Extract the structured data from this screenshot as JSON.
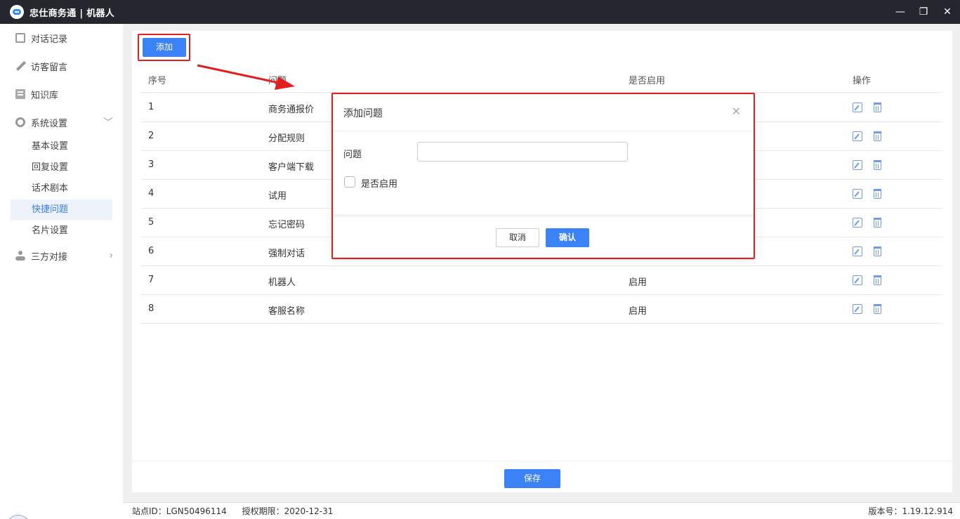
{
  "window": {
    "title": "忠仕商务通 | 机器人",
    "min_icon": "minimize-icon",
    "max_icon": "restore-icon",
    "close_icon": "close-icon"
  },
  "sidebar": {
    "items": [
      {
        "label": "对话记录",
        "icon": "chat-icon"
      },
      {
        "label": "访客留言",
        "icon": "pen-icon"
      },
      {
        "label": "知识库",
        "icon": "book-icon"
      },
      {
        "label": "系统设置",
        "icon": "gear-icon",
        "expanded": true
      },
      {
        "label": "三方对接",
        "icon": "link-icon",
        "expanded": false
      }
    ],
    "sub_items": [
      "基本设置",
      "回复设置",
      "话术剧本",
      "快捷问题",
      "名片设置"
    ],
    "active_sub": "快捷问题"
  },
  "toolbar": {
    "add_label": "添加"
  },
  "table": {
    "headers": [
      "序号",
      "问题",
      "是否启用",
      "操作"
    ],
    "rows": [
      {
        "no": "1",
        "question": "商务通报价",
        "enabled": ""
      },
      {
        "no": "2",
        "question": "分配规则",
        "enabled": ""
      },
      {
        "no": "3",
        "question": "客户端下载",
        "enabled": ""
      },
      {
        "no": "4",
        "question": "试用",
        "enabled": ""
      },
      {
        "no": "5",
        "question": "忘记密码",
        "enabled": ""
      },
      {
        "no": "6",
        "question": "强制对话",
        "enabled": ""
      },
      {
        "no": "7",
        "question": "机器人",
        "enabled": "启用"
      },
      {
        "no": "8",
        "question": "客服名称",
        "enabled": "启用"
      }
    ]
  },
  "footer": {
    "save_label": "保存"
  },
  "status": {
    "site": "站点ID：LGN50496114",
    "license": "授权期限：2020-12-31",
    "version": "版本号：1.19.12.914"
  },
  "dialog": {
    "title": "添加问题",
    "question_label": "问题",
    "question_value": "",
    "enable_label": "是否启用",
    "enable_checked": false,
    "cancel_label": "取消",
    "ok_label": "确认"
  },
  "colors": {
    "accent": "#3b82f6",
    "highlight": "#e02020",
    "titlebar": "#25272e"
  }
}
